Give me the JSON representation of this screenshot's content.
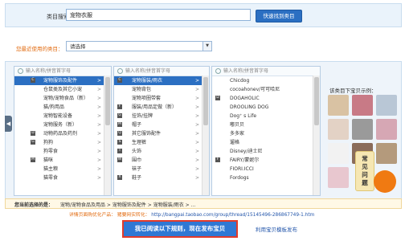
{
  "search": {
    "label": "类目搜索：",
    "value": "宠物衣服",
    "button": "快速找到类目"
  },
  "recent": {
    "label": "您最近使用的类目：",
    "select_value": "请选择",
    "arrow": "▼"
  },
  "columns": [
    {
      "placeholder": "输入名称/拼音首字母",
      "rows": [
        {
          "letter": "C",
          "label": "宠物服饰及配件",
          "chev": ">",
          "selected": true
        },
        {
          "letter": "",
          "label": "仓鼠类及其它小宠",
          "chev": ">"
        },
        {
          "letter": "",
          "label": "宠物/宠物食品（新）",
          "chev": ">"
        },
        {
          "letter": "",
          "label": "猫/狗用品",
          "chev": ">"
        },
        {
          "letter": "",
          "label": "宠物智能设备",
          "chev": ">"
        },
        {
          "letter": "",
          "label": "宠物服务（新）",
          "chev": ">"
        },
        {
          "letter": "D",
          "label": "动物药品及药剂",
          "chev": ">"
        },
        {
          "letter": "G",
          "label": "狗狗",
          "chev": ">"
        },
        {
          "letter": "",
          "label": "狗零食",
          "chev": ">"
        },
        {
          "letter": "M",
          "label": "猫咪",
          "chev": ">"
        },
        {
          "letter": "",
          "label": "猫主粮",
          "chev": ">"
        },
        {
          "letter": "",
          "label": "猫零食",
          "chev": ">"
        }
      ]
    },
    {
      "placeholder": "输入名称/拼音首字母",
      "rows": [
        {
          "letter": "C",
          "label": "宠物服装/雨衣",
          "chev": ">",
          "selected": true
        },
        {
          "letter": "",
          "label": "宠物背包",
          "chev": ">"
        },
        {
          "letter": "",
          "label": "宠物项圈带套",
          "chev": ">"
        },
        {
          "letter": "F",
          "label": "服装/用品定做（新）",
          "chev": ">"
        },
        {
          "letter": "G",
          "label": "挂饰/挂牌",
          "chev": ">"
        },
        {
          "letter": "M",
          "label": "帽子",
          "chev": ">"
        },
        {
          "letter": "Q",
          "label": "其它服饰配件",
          "chev": ">"
        },
        {
          "letter": "S",
          "label": "生理裤",
          "chev": ">"
        },
        {
          "letter": "T",
          "label": "头饰",
          "chev": ">"
        },
        {
          "letter": "W",
          "label": "围巾",
          "chev": ">"
        },
        {
          "letter": "",
          "label": "袜子",
          "chev": ">"
        },
        {
          "letter": "X",
          "label": "鞋子",
          "chev": ">"
        }
      ]
    },
    {
      "placeholder": "输入名称/拼音首字母",
      "rows": [
        {
          "letter": "",
          "label": "Chicdog",
          "chev": ""
        },
        {
          "letter": "",
          "label": "cocoahonev/可可哈尼",
          "chev": ""
        },
        {
          "letter": "D",
          "label": "DOGAHOLIC",
          "chev": ""
        },
        {
          "letter": "",
          "label": "DROOLING DOG",
          "chev": ""
        },
        {
          "letter": "",
          "label": "Dog⁺ s Life",
          "chev": ""
        },
        {
          "letter": "",
          "label": "嘟贝贝",
          "chev": ""
        },
        {
          "letter": "",
          "label": "多多家",
          "chev": ""
        },
        {
          "letter": "",
          "label": "遛格",
          "chev": ""
        },
        {
          "letter": "",
          "label": "Disney/迪士尼",
          "chev": ""
        },
        {
          "letter": "F",
          "label": "FAIRY/蒙妮尔",
          "chev": ""
        },
        {
          "letter": "",
          "label": "FIORI.ICCI",
          "chev": ""
        },
        {
          "letter": "",
          "label": "Fordogs",
          "chev": ""
        }
      ]
    }
  ],
  "example": {
    "title": "该类目下宝贝示例：",
    "help": "常见问题",
    "tile_colors": [
      "#d9c2a3",
      "#c87a86",
      "#b9c7d6",
      "#e3d2c5",
      "#9a9a9a",
      "#d6a7b4",
      "#f2f2f2",
      "#8a6c5a",
      "#b49a7c",
      "#e8c7cf",
      "#7f8ea6",
      "#d9d1c2"
    ]
  },
  "selected": {
    "label": "您当前选择的是：",
    "path": "宠物/宠物食品及用品 > 宠物服饰及配件 > 宠物服装/雨衣 > ..."
  },
  "detail": {
    "prefix": "详情页面购优化产品：",
    "link_label": "猪要网实转化：",
    "url": "http://bangpai.taobao.com/group/thread/15145496-286867749-1.htm"
  },
  "actions": {
    "confirm": "我已阅读以下规则，现在发布宝贝",
    "secondary": "利用宝贝模板发布"
  },
  "colors": {
    "accent": "#2f78d4",
    "selected_row": "#2b6fc2",
    "highlight_border": "#e23b2b",
    "recent_label": "#e26b10"
  }
}
